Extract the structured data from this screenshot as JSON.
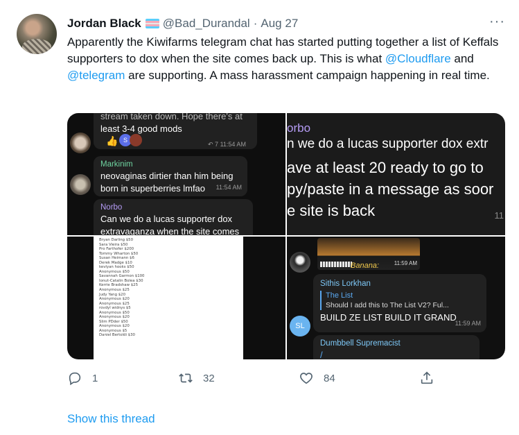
{
  "author": {
    "name": "Jordan Black",
    "handle": "@Bad_Durandal",
    "separator": "·",
    "date": "Aug 27",
    "flag_colors": [
      "#5bcefa",
      "#f5a9b8",
      "#ffffff",
      "#f5a9b8",
      "#5bcefa"
    ]
  },
  "more_icon": "···",
  "tweet": {
    "text_1": "Apparently the Kiwifarms telegram chat has started putting together a list of Keffals supporters to dox when the site comes back up. This is what ",
    "mention_1": "@Cloudflare",
    "text_2": " and ",
    "mention_2": "@telegram",
    "text_3": " are supporting. A mass harassment campaign happening in real time."
  },
  "media": {
    "img1": {
      "top_text_1": "stream taken down. Hope there's at",
      "top_text_2": "least 3-4 good mods",
      "reaction_count": "7",
      "reaction_time": "11:54 AM",
      "reaction_letter": "S",
      "msg1_sender": "Markinim",
      "msg1_line1": "neovaginas dirtier than him being",
      "msg1_line2": "born in superberries lmfao",
      "msg1_time": "11:54 AM",
      "msg2_sender": "Norbo",
      "msg2_line1": "Can we do a lucas supporter dox",
      "msg2_line2": "extravaganza when the site comes"
    },
    "img2": {
      "sender": "orbo",
      "line1": "n we do a lucas supporter dox extr",
      "line2": "ave at least 20 ready to go to",
      "line3": "py/paste in a message as soor",
      "line4": "e site is back",
      "time": "11"
    },
    "img3": {
      "rows": [
        "Bryan Darling $50",
        "Sara Vieira $50",
        "Pro Farthofer $200",
        "Tommy Wharton $50",
        "Susan Heimann $6",
        "Derek Madge $10",
        "kevlyan hooks $50",
        "Anonymous $50",
        "Savannah Garmon $100",
        "Ionut-Catalin Bolea $30",
        "Kerrie Bradshaw $25",
        "Anonymous $25",
        "Judy Yang $20",
        "Anonymous $20",
        "Anonymous $25",
        "rovdyl widnys $5",
        "Anonymous $50",
        "Anonymous $20",
        "Slim PDder $50",
        "Anonymous $20",
        "Anonymous $5",
        "Daniel Bertoldi $30"
      ]
    },
    "img4": {
      "banner_text": "Banana:",
      "banner_time": "11:59 AM",
      "msg1_sender": "Sithis Lorkhan",
      "quote_title": "The List",
      "quote_text": "Should I add this to The List V2? Ful...",
      "msg1_text": "BUILD ZE LIST BUILD IT GRAND",
      "msg1_time": "11:59 AM",
      "avatar_initials": "SL",
      "msg2_sender": "Dumbbell Supremacist",
      "msg2_text": "/"
    }
  },
  "actions": {
    "replies": "1",
    "retweets": "32",
    "likes": "84"
  },
  "show_thread": "Show this thread"
}
